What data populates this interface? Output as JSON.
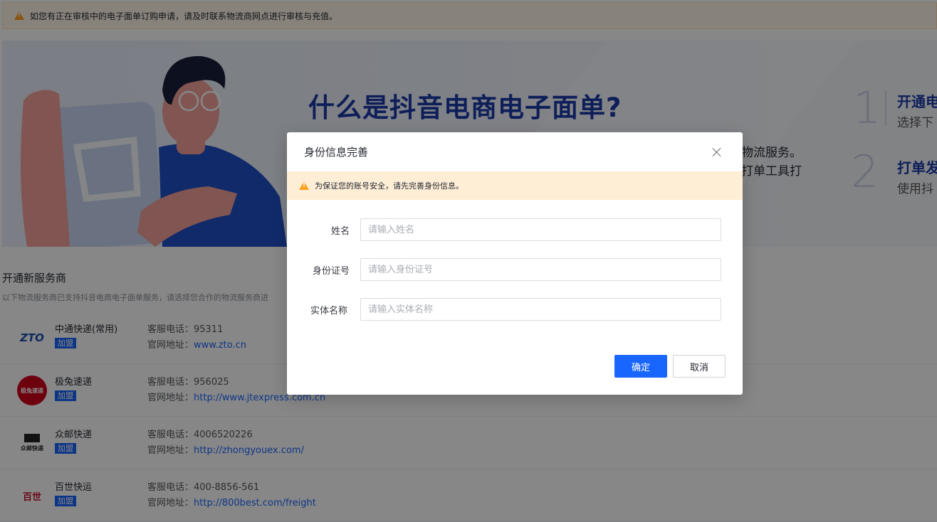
{
  "top_notice": {
    "text": "如您有正在审核中的电子面单订购申请，请及时联系物流商网点进行审核与充值。"
  },
  "banner": {
    "title": "什么是抖音电商电子面单?",
    "text_line1": "物流服务。",
    "text_line2": "打单工具打",
    "steps": [
      {
        "num": "1",
        "title": "开通电",
        "sub": "选择下"
      },
      {
        "num": "2",
        "title": "打单发",
        "sub": "使用抖"
      }
    ]
  },
  "section": {
    "title": "开通新服务商",
    "subtitle": "以下物流服务商已支持抖音电商电子面单服务，请选择您合作的物流服务商进"
  },
  "providers": [
    {
      "logo_text": "ZTO",
      "name": "中通快递(常用)",
      "tag": "加盟",
      "phone_label": "客服电话：",
      "phone": "95311",
      "site_label": "官网地址：",
      "site": "www.zto.cn"
    },
    {
      "logo_text": "极兔速递",
      "name": "极兔速递",
      "tag": "加盟",
      "phone_label": "客服电话：",
      "phone": "956025",
      "site_label": "官网地址：",
      "site": "http://www.jtexpress.com.cn"
    },
    {
      "logo_text": "众邮快递",
      "name": "众邮快递",
      "tag": "加盟",
      "phone_label": "客服电话：",
      "phone": "4006520226",
      "site_label": "官网地址：",
      "site": "http://zhongyouex.com/"
    },
    {
      "logo_text": "百世",
      "name": "百世快运",
      "tag": "加盟",
      "phone_label": "客服电话：",
      "phone": "400-8856-561",
      "site_label": "官网地址：",
      "site": "http://800best.com/freight"
    }
  ],
  "modal": {
    "title": "身份信息完善",
    "notice": "为保证您的账号安全，请先完善身份信息。",
    "fields": [
      {
        "label": "姓名",
        "placeholder": "请输入姓名",
        "value": ""
      },
      {
        "label": "身份证号",
        "placeholder": "请输入身份证号",
        "value": ""
      },
      {
        "label": "实体名称",
        "placeholder": "请输入实体名称",
        "value": ""
      }
    ],
    "ok_label": "确定",
    "cancel_label": "取消"
  },
  "colors": {
    "primary": "#1966ff",
    "warning": "#ff9f1a",
    "banner_title": "#1b3aa8"
  }
}
